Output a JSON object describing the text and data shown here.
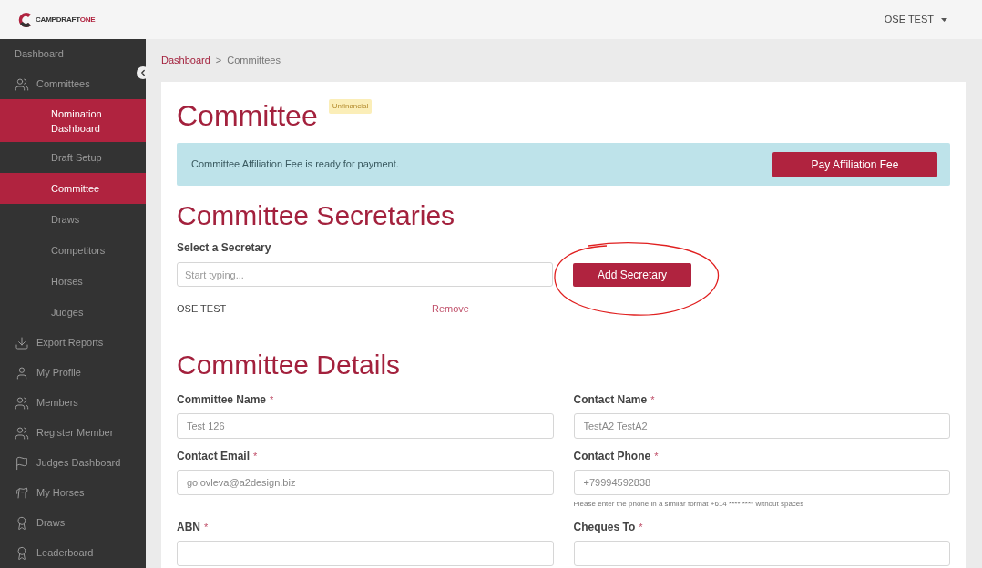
{
  "logo": {
    "text": "CAMPDRAFT",
    "accent": "ONE"
  },
  "user_menu": {
    "name": "OSE TEST"
  },
  "sidebar": {
    "items": [
      {
        "kind": "top",
        "label": "Dashboard",
        "selected": false
      },
      {
        "kind": "icon",
        "label": "Committees",
        "selected": false
      },
      {
        "kind": "sub",
        "label": "Nomination Dashboard",
        "selected": true
      },
      {
        "kind": "sub",
        "label": "Draft Setup",
        "selected": false
      },
      {
        "kind": "sub",
        "label": "Committee",
        "selected": true
      },
      {
        "kind": "sub",
        "label": "Draws",
        "selected": false
      },
      {
        "kind": "sub",
        "label": "Competitors",
        "selected": false
      },
      {
        "kind": "sub",
        "label": "Horses",
        "selected": false
      },
      {
        "kind": "sub",
        "label": "Judges",
        "selected": false
      },
      {
        "kind": "icon",
        "label": "Export Reports",
        "selected": false
      },
      {
        "kind": "icon",
        "label": "My Profile",
        "selected": false
      },
      {
        "kind": "icon",
        "label": "Members",
        "selected": false
      },
      {
        "kind": "icon",
        "label": "Register Member",
        "selected": false
      },
      {
        "kind": "icon",
        "label": "Judges Dashboard",
        "selected": false
      },
      {
        "kind": "icon",
        "label": "My Horses",
        "selected": false
      },
      {
        "kind": "icon",
        "label": "Draws",
        "selected": false
      },
      {
        "kind": "icon",
        "label": "Leaderboard",
        "selected": false
      }
    ]
  },
  "breadcrumb": [
    {
      "label": "Dashboard",
      "kind": "link"
    },
    {
      "label": ">",
      "kind": "separator"
    },
    {
      "label": "Committees",
      "kind": "current"
    }
  ],
  "page": {
    "title": "Committee",
    "badge": "Unfinancial"
  },
  "alert": {
    "message": "Committee Affiliation Fee is ready for payment.",
    "button": "Pay Affiliation Fee"
  },
  "secretaries": {
    "heading": "Committee Secretaries",
    "label": "Select a Secretary",
    "placeholder": "Start typing...",
    "button": "Add Secretary",
    "list": [
      {
        "name": "OSE TEST",
        "action": "Remove"
      }
    ]
  },
  "details": {
    "heading": "Committee Details",
    "fields": [
      {
        "label": "Committee Name",
        "required_mark": "*",
        "value": "Test 126"
      },
      {
        "label": "Contact Name",
        "required_mark": "*",
        "value": "TestA2 TestA2"
      },
      {
        "label": "Contact Email",
        "required_mark": "*",
        "value": "golovleva@a2design.biz"
      },
      {
        "label": "Contact Phone",
        "required_mark": "*",
        "value": "+79994592838",
        "help": "Please enter the phone in a similar format +614 **** **** without spaces"
      },
      {
        "label": "ABN",
        "required_mark": "*"
      },
      {
        "label": "Cheques To",
        "required_mark": "*"
      }
    ]
  }
}
